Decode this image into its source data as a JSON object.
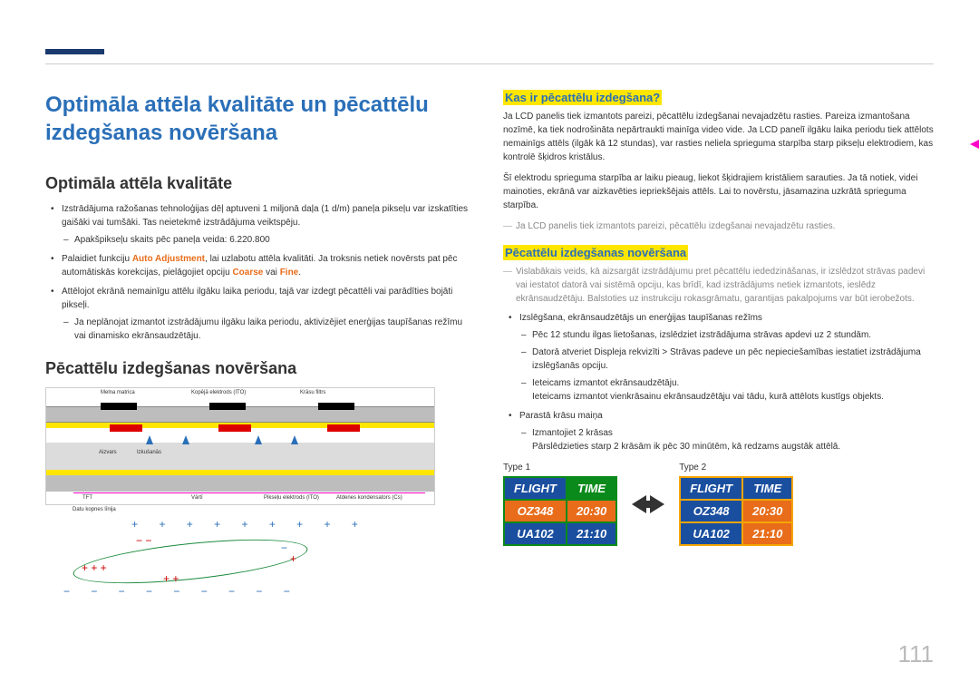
{
  "page_number": "111",
  "main_title": "Optimāla attēla kvalitāte un pēcattēlu izdegšanas novēršana",
  "left": {
    "h2_quality": "Optimāla attēla kvalitāte",
    "b1": "Izstrādājuma ražošanas tehnoloģijas dēļ aptuveni 1 miljonā daļa (1 d/m) paneļa pikseļu var izskatīties gaišāki vai tumšāki. Tas neietekmē izstrādājuma veiktspēju.",
    "b1d1": "Apakšpikseļu skaits pēc paneļa veida: 6.220.800",
    "b2a": "Palaidiet funkciju ",
    "b2_orange1": "Auto Adjustment",
    "b2b": ", lai uzlabotu attēla kvalitāti. Ja troksnis netiek novērsts pat pēc automātiskās korekcijas, pielāgojiet opciju ",
    "b2_orange2": "Coarse",
    "b2c": " vai ",
    "b2_orange3": "Fine",
    "b2d": ".",
    "b3": "Attēlojot ekrānā nemainīgu attēlu ilgāku laika periodu, tajā var izdegt pēcattēli vai parādīties bojāti pikseļi.",
    "b3d1": "Ja neplānojat izmantot izstrādājumu ilgāku laika periodu, aktivizējiet enerģijas taupīšanas režīmu vai dinamisko ekrānsaudzētāju.",
    "h2_prevent": "Pēcattēlu izdegšanas novēršana",
    "diag": {
      "l1": "Melna matrica",
      "l2": "Kopējā elektrods (ITO)",
      "l3": "Krāsu filtrs",
      "l4": "TFT",
      "l5": "Pikseļu elektrods (ITO)",
      "l6": "Atdenes kondensators (Cs)",
      "l7": "Datu kopnes līnija",
      "l8": "Aizvars",
      "l9": "Izkušanās",
      "l10": "Vārtī"
    }
  },
  "right": {
    "h3_what": "Kas ir pēcattēlu izdegšana?",
    "p1": "Ja LCD panelis tiek izmantots pareizi, pēcattēlu izdegšanai nevajadzētu rasties. Pareiza izmantošana nozīmē, ka tiek nodrošināta nepārtraukti mainīga video vide. Ja LCD panelī ilgāku laika periodu tiek attēlots nemainīgs attēls (ilgāk kā 12 stundas), var rasties neliela sprieguma starpība starp pikseļu elektrodiem, kas kontrolē šķidros kristālus.",
    "p2": "Šī elektrodu sprieguma starpība ar laiku pieaug, liekot šķidrajiem kristāliem sarauties. Ja tā notiek, videi mainoties, ekrānā var aizkavēties iepriekšējais attēls. Lai to novērstu, jāsamazina uzkrātā sprieguma starpība.",
    "note1": "Ja LCD panelis tiek izmantots pareizi, pēcattēlu izdegšanai nevajadzētu rasties.",
    "h3_prev": "Pēcattēlu izdegšanas novēršana",
    "note2": "Vislabākais veids, kā aizsargāt izstrādājumu pret pēcattēlu iededzināšanas, ir izslēdzot strāvas padevi vai iestatot datorā vai sistēmā opciju, kas brīdī, kad izstrādājums netiek izmantots, ieslēdz ekrānsaudzētāju. Balstoties uz instrukciju rokasgrāmatu, garantijas pakalpojums var būt ierobežots.",
    "b1": "Izslēgšana, ekrānsaudzētājs un enerģijas taupīšanas režīms",
    "b1d1": "Pēc 12 stundu ilgas lietošanas, izslēdziet izstrādājuma strāvas apdevi uz 2 stundām.",
    "b1d2": "Datorā atveriet Displeja rekvizīti > Strāvas padeve un pēc nepieciešamības iestatiet izstrādājuma izslēgšanās opciju.",
    "b1d3": "Ieteicams izmantot ekrānsaudzētāju.",
    "b1d3b": "Ieteicams izmantot vienkrāsainu ekrānsaudzētāju vai tādu, kurā attēlots kustīgs objekts.",
    "b2": "Parastā krāsu maiņa",
    "b2d1": "Izmantojiet 2 krāsas",
    "b2d1b": "Pārslēdzieties starp 2 krāsām ik pēc 30 minūtēm, kā redzams augstāk attēlā.",
    "flight": {
      "type1": "Type 1",
      "type2": "Type 2",
      "h_flight": "FLIGHT",
      "h_time": "TIME",
      "r1c1": "OZ348",
      "r1c2": "20:30",
      "r2c1": "UA102",
      "r2c2": "21:10"
    }
  }
}
